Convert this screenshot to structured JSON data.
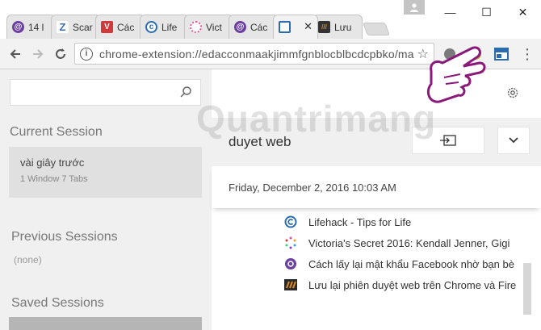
{
  "window": {
    "tabs": [
      {
        "title": "14 l",
        "icon": "quantrimang-icon",
        "color": "#6b3fa0"
      },
      {
        "title": "Scar",
        "icon": "zotero-icon",
        "color": "#3a6fb0"
      },
      {
        "title": "Các",
        "icon": "vivaldi-icon",
        "color": "#d23a3a"
      },
      {
        "title": "Life",
        "icon": "lifehack-icon",
        "color": "#2b6cb0"
      },
      {
        "title": "Vict",
        "icon": "victoria-icon",
        "color": "#e0559a"
      },
      {
        "title": "Các",
        "icon": "quantrimang-icon",
        "color": "#6b3fa0"
      },
      {
        "title": "",
        "icon": "session-buddy-icon",
        "color": "#2b6cb0"
      },
      {
        "title": "Lưu",
        "icon": "download-icon",
        "color": "#e08a1a"
      }
    ],
    "controls": {
      "minimize": "—",
      "maximize": "☐",
      "close": "✕"
    }
  },
  "toolbar": {
    "url": "chrome-extension://edacconmaakjimmfgnblocblbcdcpbko/ma",
    "star": "☆"
  },
  "left": {
    "search_placeholder": "",
    "current_title": "Current Session",
    "current_time": "vài giây trước",
    "current_meta": "1 Window  7 Tabs",
    "previous_title": "Previous Sessions",
    "previous_none": "(none)",
    "saved_title": "Saved Sessions"
  },
  "right": {
    "session_name": "duyet web",
    "date": "Friday, December 2, 2016 10:03 AM",
    "tabs": [
      {
        "label": "Lifehack - Tips for Life",
        "icon": "lifehack-icon"
      },
      {
        "label": "Victoria's Secret 2016: Kendall Jenner, Gigi",
        "icon": "victoria-icon"
      },
      {
        "label": "Cách lấy lại mật khẩu Facebook nhờ bạn bè",
        "icon": "quantrimang-icon"
      },
      {
        "label": "Lưu lại phiên duyệt web trên Chrome và Fire",
        "icon": "download-icon"
      }
    ]
  },
  "watermark": "Quantrimang"
}
